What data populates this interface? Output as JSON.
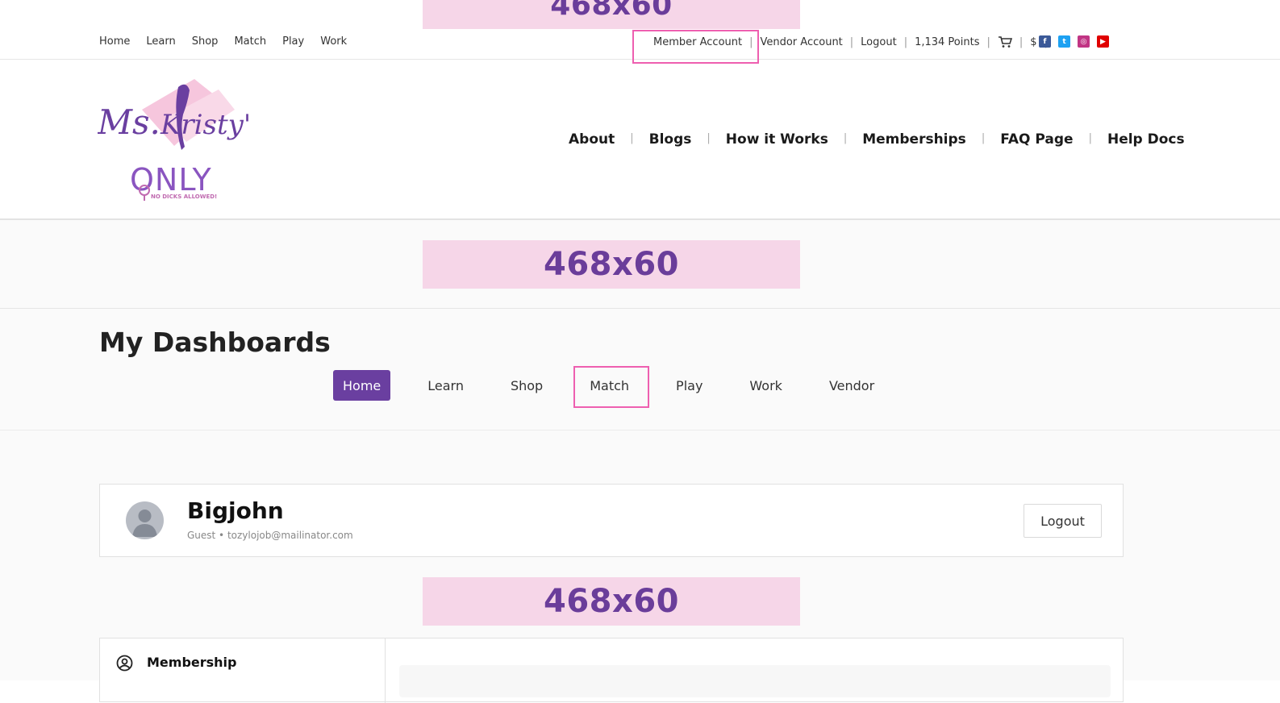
{
  "ads": {
    "top": "468x60",
    "banner": "468x60",
    "inline": "468x60"
  },
  "topnav": [
    "Home",
    "Learn",
    "Shop",
    "Match",
    "Play",
    "Work"
  ],
  "utility": {
    "member_account": "Member Account",
    "vendor_account": "Vendor Account",
    "logout": "Logout",
    "points": "1,134 Points",
    "currency": "$"
  },
  "logo": {
    "script": "Ms.Kristy's",
    "only": "ONLY",
    "tagline": "NO DICKS ALLOWED!"
  },
  "mainnav": [
    "About",
    "Blogs",
    "How it Works",
    "Memberships",
    "FAQ Page",
    "Help Docs"
  ],
  "dashboard": {
    "title": "My Dashboards",
    "tabs": [
      "Home",
      "Learn",
      "Shop",
      "Match",
      "Play",
      "Work",
      "Vendor"
    ],
    "active_tab": "Home"
  },
  "profile": {
    "name": "Bigjohn",
    "meta": "Guest • tozylojob@mailinator.com",
    "logout": "Logout"
  },
  "membership": {
    "label": "Membership"
  },
  "colors": {
    "accent": "#6a3fa0",
    "highlight": "#ee5fb0",
    "ad_bg": "#f6d6e8"
  }
}
